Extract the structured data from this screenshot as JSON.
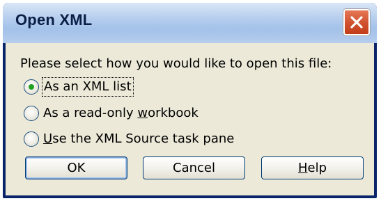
{
  "dialog": {
    "title": "Open XML",
    "prompt": "Please select how you would like to open this file:",
    "options": [
      {
        "label": "As an XML list",
        "selected": true,
        "mnemonic_pre": "",
        "mnemonic": "",
        "mnemonic_post": ""
      },
      {
        "label_pre": "As a read-only ",
        "mnemonic": "w",
        "label_post": "orkbook",
        "selected": false
      },
      {
        "label_pre": "",
        "mnemonic": "U",
        "label_post": "se the XML Source task pane",
        "selected": false
      }
    ],
    "buttons": {
      "ok": "OK",
      "cancel": "Cancel",
      "help_mnemonic": "H",
      "help_rest": "elp"
    },
    "close_icon": "close-icon",
    "colors": {
      "accent": "#21a121",
      "close": "#d0502e",
      "titlebar": "#b9d0ee"
    }
  }
}
